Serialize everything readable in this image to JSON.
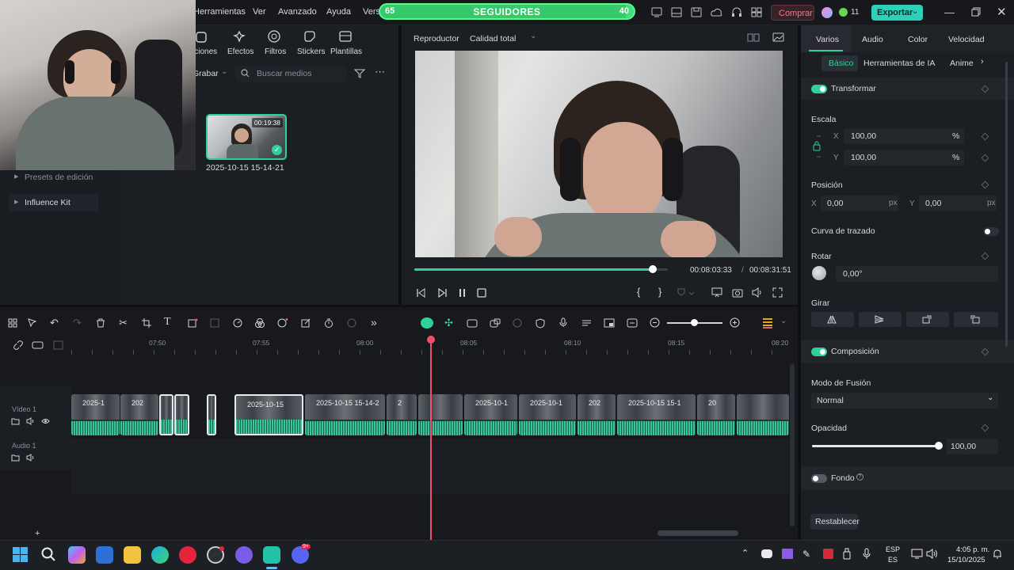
{
  "menubar": {
    "items": [
      "Herramientas",
      "Ver",
      "Avanzado",
      "Ayuda",
      "Versi"
    ],
    "buy_label": "Comprar",
    "credits": "11",
    "export_label": "Exportar"
  },
  "followers": {
    "left": "65",
    "label": "SEGUIDORES",
    "right": "40",
    "progress": 0.97
  },
  "media": {
    "tabs": [
      "iciones",
      "Efectos",
      "Filtros",
      "Stickers",
      "Plantillas"
    ],
    "record_label": "Grabar",
    "search_placeholder": "Buscar medios",
    "thumb_duration": "00:19:38",
    "thumb_name": "2025-10-15 15-14-21",
    "side_items": [
      "Presets de edición",
      "Influence Kit"
    ]
  },
  "player": {
    "tab_label": "Reproductor",
    "quality_label": "Calidad total",
    "current_time": "00:08:03:33",
    "separator": "/",
    "total_time": "00:08:31:51",
    "progress": 0.94
  },
  "props": {
    "tabs": [
      "Varios",
      "Audio",
      "Color",
      "Velocidad"
    ],
    "subtabs": [
      "Básico",
      "Herramientas de IA",
      "Anime"
    ],
    "transform_label": "Transformar",
    "scale_label": "Escala",
    "scale_x": "100,00",
    "scale_y": "100,00",
    "percent": "%",
    "x_label": "X",
    "y_label": "Y",
    "position_label": "Posición",
    "pos_x": "0,00",
    "pos_y": "0,00",
    "px": "px",
    "path_curve_label": "Curva de trazado",
    "rotate_label": "Rotar",
    "rotate_value": "0,00°",
    "flip_label": "Girar",
    "composition_label": "Composición",
    "blend_label": "Modo de Fusión",
    "blend_value": "Normal",
    "opacity_label": "Opacidad",
    "opacity_value": "100,00",
    "opacity_level": 1.0,
    "background_label": "Fondo",
    "reset_label": "Restablecer"
  },
  "timeline": {
    "ruler": [
      "07:50",
      "07:55",
      "08:00",
      "08:05",
      "08:10",
      "08:15",
      "08:20"
    ],
    "video_track": "Vídeo 1",
    "audio_track": "Audio 1",
    "clip_names": [
      "2025-1",
      "202",
      "2025-10-15",
      "2025-10-15 15-14-2",
      "2",
      "2025-10-1",
      "2025-10-1",
      "202",
      "2025-10-15 15-1",
      "20"
    ]
  },
  "taskbar": {
    "lang1": "ESP",
    "lang2": "ES",
    "time": "4:05 p. m.",
    "date": "15/10/2025",
    "badge": "9+"
  },
  "colors": {
    "accent": "#2ed19a",
    "follower_green": "#3fe07c",
    "playhead": "#f0506e",
    "buy": "#e0566e"
  }
}
